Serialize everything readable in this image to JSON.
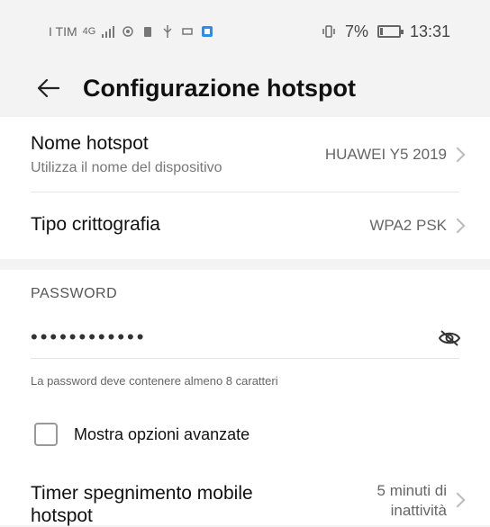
{
  "status_bar": {
    "carrier": "I TIM",
    "signal": "4G",
    "battery_text": "7%",
    "time": "13:31"
  },
  "header": {
    "title": "Configurazione hotspot"
  },
  "settings": {
    "hotspot_name": {
      "title": "Nome hotspot",
      "subtitle": "Utilizza il nome del dispositivo",
      "value": "HUAWEI Y5 2019"
    },
    "encryption": {
      "title": "Tipo crittografia",
      "value": "WPA2 PSK"
    },
    "password": {
      "section_label": "PASSWORD",
      "masked_value": "••••••••••••",
      "hint": "La password deve contenere almeno 8 caratteri"
    },
    "advanced": {
      "label": "Mostra opzioni avanzate",
      "checked": false
    },
    "timer": {
      "title": "Timer spegnimento mobile hotspot",
      "value_line1": "5 minuti di",
      "value_line2": "inattività"
    }
  },
  "icons": {
    "back": "arrow-left-icon",
    "eye": "eye-off-icon",
    "chevron": "chevron-right-icon"
  }
}
